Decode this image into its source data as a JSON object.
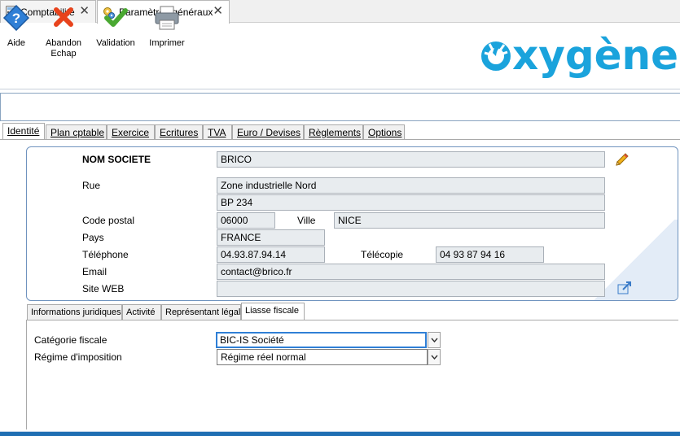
{
  "doc_tabs": [
    {
      "label": "Comptabilité",
      "icon": "calculator-icon"
    },
    {
      "label": "Paramètres généraux",
      "icon": "settings-icon"
    }
  ],
  "toolbar": {
    "help": {
      "label": "Aide",
      "icon": "help-icon"
    },
    "abandon": {
      "label": "Abandon",
      "sublabel": "Echap",
      "icon": "cancel-x-icon"
    },
    "validate": {
      "label": "Validation",
      "icon": "checkmark-icon"
    },
    "print": {
      "label": "Imprimer",
      "icon": "printer-icon"
    }
  },
  "logo": {
    "text": "xygène",
    "brand_color": "#1aa3dc"
  },
  "main_tabs": [
    "Identité",
    "Plan cptable",
    "Exercice",
    "Ecritures",
    "TVA",
    "Euro / Devises",
    "Règlements",
    "Options"
  ],
  "active_main_tab": "Identité",
  "identity": {
    "company_label": "NOM SOCIETE",
    "company_value": "BRICO",
    "street_label": "Rue",
    "street_line1": "Zone industrielle Nord",
    "street_line2": "BP 234",
    "postal_label": "Code postal",
    "postal_value": "06000",
    "city_label": "Ville",
    "city_value": "NICE",
    "country_label": "Pays",
    "country_value": "FRANCE",
    "phone_label": "Téléphone",
    "phone_value": "04.93.87.94.14",
    "fax_label": "Télécopie",
    "fax_value": "04 93 87 94 16",
    "email_label": "Email",
    "email_value": "contact@brico.fr",
    "web_label": "Site WEB",
    "web_value": ""
  },
  "sub_tabs": [
    "Informations juridiques",
    "Activité",
    "Représentant légal",
    "Liasse fiscale"
  ],
  "active_sub_tab": "Liasse fiscale",
  "fiscal": {
    "category_label": "Catégorie fiscale",
    "category_value": "BIC-IS Société",
    "regime_label": "Régime d'imposition",
    "regime_value": "Régime réel normal"
  },
  "colors": {
    "accent": "#1f6fb3",
    "panel_border": "#6f93bf",
    "field_bg": "#e8ecef"
  }
}
